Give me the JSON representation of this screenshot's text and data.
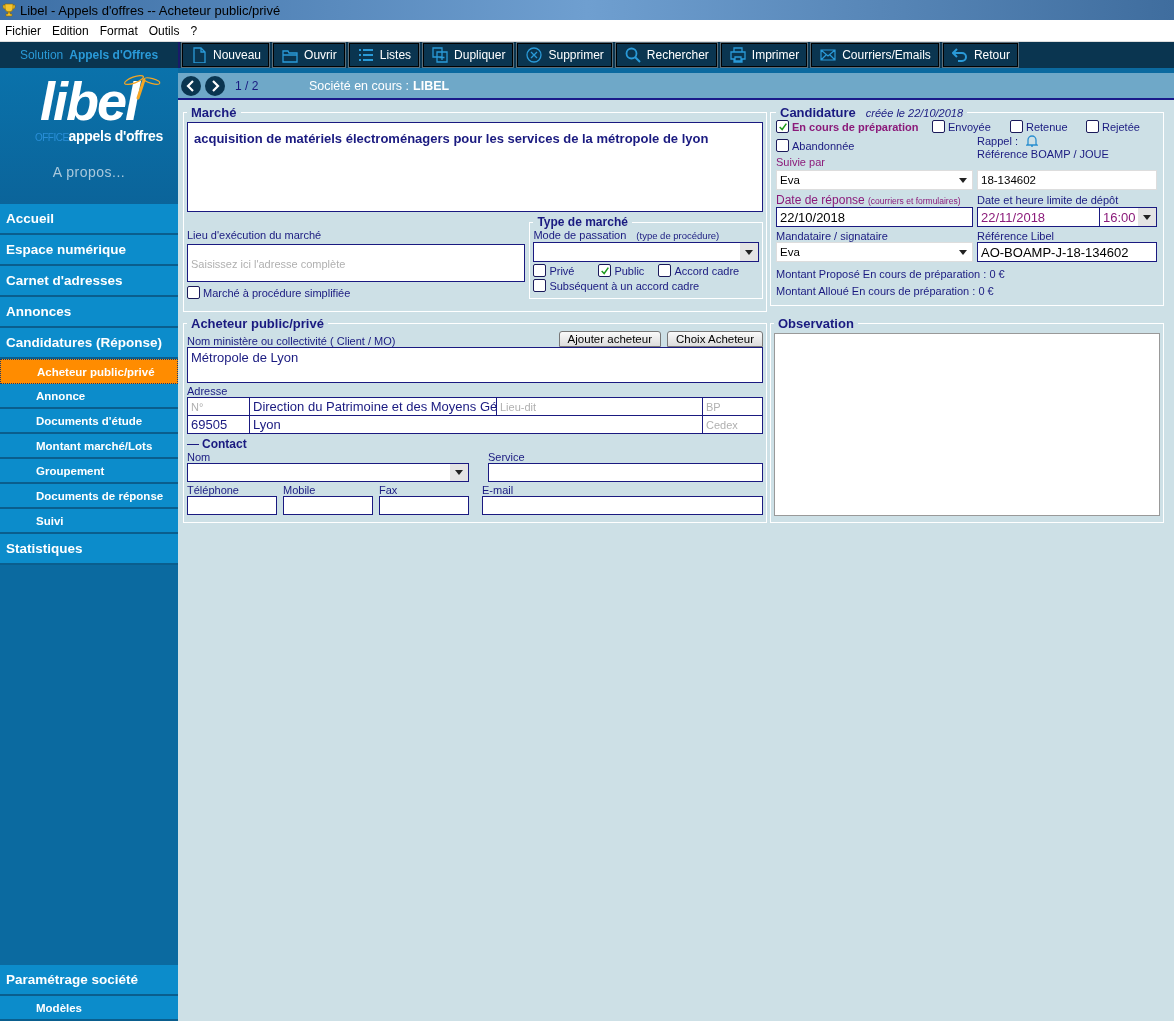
{
  "window": {
    "title": "Libel - Appels d'offres -- Acheteur public/privé"
  },
  "menu": [
    "Fichier",
    "Edition",
    "Format",
    "Outils",
    "?"
  ],
  "toolbar": {
    "solution_label": "Solution",
    "solution_name": "Appels d'Offres",
    "buttons": [
      "Nouveau",
      "Ouvrir",
      "Listes",
      "Dupliquer",
      "Supprimer",
      "Rechercher",
      "Imprimer",
      "Courriers/Emails",
      "Retour"
    ]
  },
  "logo": {
    "name": "libel",
    "office": "OFFICE",
    "product": "appels d'offres"
  },
  "sidebar": {
    "about": "A propos...",
    "items": [
      {
        "label": "Accueil",
        "selected": false
      },
      {
        "label": "Espace numérique",
        "selected": false
      },
      {
        "label": "Carnet d'adresses",
        "selected": false
      },
      {
        "label": "Annonces",
        "selected": false
      },
      {
        "label": "Candidatures  (Réponse)",
        "selected": false,
        "children": [
          {
            "label": "Acheteur public/privé",
            "selected": true
          },
          {
            "label": "Annonce",
            "selected": false
          },
          {
            "label": "Documents d'étude",
            "selected": false
          },
          {
            "label": "Montant marché/Lots",
            "selected": false
          },
          {
            "label": "Groupement",
            "selected": false
          },
          {
            "label": "Documents de réponse",
            "selected": false
          },
          {
            "label": "Suivi",
            "selected": false
          }
        ]
      },
      {
        "label": "Statistiques",
        "selected": false
      }
    ],
    "bottom_items": [
      {
        "label": "Paramétrage société",
        "selected": false,
        "children": [
          {
            "label": "Modèles",
            "selected": false
          }
        ]
      }
    ]
  },
  "record_nav": {
    "position": "1 / 2",
    "company_label": "Société en cours :",
    "company": "LIBEL"
  },
  "marche": {
    "title": "Marché",
    "object": "acquisition de matériels électroménagers pour les services de la métropole de lyon",
    "lieu_label": "Lieu d'exécution du marché",
    "lieu_placeholder": "Saisissez ici l'adresse complète",
    "simplified": {
      "label": "Marché à procédure simplifiée",
      "checked": false
    },
    "type": {
      "title": "Type de marché",
      "mode_label": "Mode de passation",
      "mode_hint": "(type de procédure)",
      "options": [
        {
          "label": "Privé",
          "checked": false
        },
        {
          "label": "Public",
          "checked": true
        },
        {
          "label": "Accord cadre",
          "checked": false
        },
        {
          "label": "Subséquent à un accord cadre",
          "checked": false
        }
      ]
    }
  },
  "candidature": {
    "title": "Candidature",
    "created": "créée le 22/10/2018",
    "statuses": [
      {
        "label": "En cours de préparation",
        "checked": true
      },
      {
        "label": "Envoyée",
        "checked": false
      },
      {
        "label": "Retenue",
        "checked": false
      },
      {
        "label": "Rejetée",
        "checked": false
      },
      {
        "label": "Abandonnée",
        "checked": false
      }
    ],
    "rappel_label": "Rappel :",
    "suivie_label": "Suivie par",
    "suivie": "Eva",
    "ref_boamp_label": "Référence BOAMP / JOUE",
    "ref_boamp": "18-134602",
    "date_reponse_label": "Date de réponse",
    "date_reponse_hint": "(courriers et formulaires)",
    "date_reponse": "22/10/2018",
    "limite_label": "Date et heure limite de dépôt",
    "limite_date": "22/11/2018",
    "limite_time": "16:00",
    "mandataire_label": "Mandataire / signataire",
    "mandataire": "Eva",
    "ref_libel_label": "Référence Libel",
    "ref_libel": "AO-BOAMP-J-18-134602",
    "montant_propose": "Montant Proposé En cours de préparation : 0 €",
    "montant_alloue": "Montant Alloué En cours de préparation : 0 €"
  },
  "acheteur": {
    "title": "Acheteur public/privé",
    "nom_label": "Nom ministère ou collectivité ( Client / MO)",
    "buttons": [
      "Ajouter acheteur",
      "Choix Acheteur"
    ],
    "nom": "Métropole de Lyon",
    "adresse_label": "Adresse",
    "address": {
      "numero_placeholder": "N°",
      "street": "Direction du Patrimoine et des Moyens Gé",
      "lieudit_placeholder": "Lieu-dit",
      "bp_placeholder": "BP",
      "postcode": "69505",
      "city": "Lyon",
      "cedex_placeholder": "Cedex"
    },
    "contact_title": "Contact",
    "contact_labels": [
      "Nom",
      "Service",
      "Téléphone",
      "Mobile",
      "Fax",
      "E-mail"
    ]
  },
  "observation": {
    "title": "Observation"
  }
}
